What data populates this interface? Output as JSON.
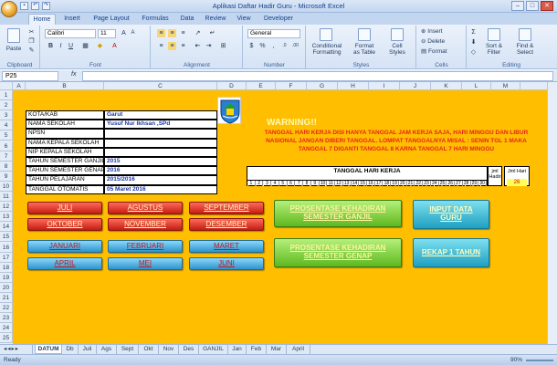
{
  "window": {
    "title": "Aplikasi Daftar Hadir Guru - Microsoft Excel"
  },
  "ribbon_tabs": [
    "Home",
    "Insert",
    "Page Layout",
    "Formulas",
    "Data",
    "Review",
    "View",
    "Developer"
  ],
  "ribbon": {
    "paste": "Paste",
    "clipboard": "Clipboard",
    "font_name": "Calibri",
    "font_size": "11",
    "font_group": "Font",
    "alignment": "Alignment",
    "number_format": "General",
    "number": "Number",
    "conditional": "Conditional\nFormatting",
    "format_table": "Format\nas Table",
    "cell_styles": "Cell\nStyles",
    "styles": "Styles",
    "insert": "Insert",
    "delete": "Delete",
    "format": "Format",
    "cells": "Cells",
    "sort": "Sort &\nFilter",
    "find": "Find &\nSelect",
    "editing": "Editing"
  },
  "formula_bar": {
    "cell_ref": "P25",
    "fx": "fx",
    "value": ""
  },
  "columns": [
    "A",
    "B",
    "C",
    "D",
    "E",
    "F",
    "G",
    "H",
    "I",
    "J",
    "K",
    "L",
    "M"
  ],
  "rows": [
    "1",
    "2",
    "3",
    "4",
    "5",
    "6",
    "7",
    "8",
    "9",
    "10",
    "11",
    "12",
    "13",
    "14",
    "15",
    "16",
    "17",
    "18",
    "19",
    "20",
    "21",
    "22",
    "23",
    "24",
    "25"
  ],
  "info_table": [
    {
      "label": "KOTA/KAB",
      "value": "Garut"
    },
    {
      "label": "NAMA SEKOLAH",
      "value": "Yusuf Nur Ikhsan ,SPd"
    },
    {
      "label": "NPSN",
      "value": ""
    },
    {
      "label": "NAMA KEPALA SEKOLAH",
      "value": ""
    },
    {
      "label": "NIP KEPALA SEKOLAH",
      "value": ""
    },
    {
      "label": "TAHUN SEMESTER GANJIL",
      "value": "2015"
    },
    {
      "label": "TAHUN SEMESTER GENAP",
      "value": "2016"
    },
    {
      "label": "TAHUN PELAJARAN",
      "value": "2015/2016"
    },
    {
      "label": "TANGGAL OTOMATIS",
      "value": "05 Maret 2016"
    }
  ],
  "warning": {
    "title": "WARNING!!",
    "text": "TANGGAL HARI KERJA DISI HANYA TANGGAL JAM KERJA SAJA, HARI MINGGU DAN LIBUR NASIONAL JANGAN DIBERI TANGGAL. LOMPAT TANGGALNYA MISAL : SENIN TGL 1 MAKA TANGGAL 7 DIGANTI TANGGAL 8 KARNA TANGGAL 7 HARI MINGGU"
  },
  "days": {
    "title": "TANGGAL HARI KERJA",
    "numbers": [
      "1",
      "2",
      "3",
      "4",
      "5",
      "6",
      "7",
      "8",
      "9",
      "10",
      "11",
      "12",
      "13",
      "14",
      "15",
      "16",
      "17",
      "18",
      "19",
      "20",
      "21",
      "22",
      "23",
      "24",
      "25",
      "26",
      "27",
      "28",
      "29",
      "30"
    ],
    "jml_label": "jml\nHadir",
    "jml_hari_label": "Jml Hari",
    "jml_hari_value": "26"
  },
  "month_buttons_red": [
    "JULI",
    "AGUSTUS",
    "SEPTEMBER",
    "OKTOBER",
    "NOVEMBER",
    "DESEMBER"
  ],
  "month_buttons_blue": [
    "JANUARI",
    "FEBRUARI",
    "MARET",
    "APRIL",
    "MEI",
    "JUNI"
  ],
  "action_buttons": {
    "ganjil": "PROSENTASE KEHADIRAN\nSEMESTER GANJIL",
    "genap": "PROSENTASE KEHADIRAN\nSEMESTER GENAP",
    "input": "INPUT DATA\nGURU",
    "rekap": "REKAP 1 TAHUN"
  },
  "sheet_tabs": [
    "DATUM",
    "Db",
    "Juli",
    "Ags",
    "Sept",
    "Okt",
    "Nov",
    "Des",
    "GANJIL",
    "Jan",
    "Feb",
    "Mar",
    "April"
  ],
  "status": {
    "ready": "Ready",
    "zoom": "90%"
  }
}
